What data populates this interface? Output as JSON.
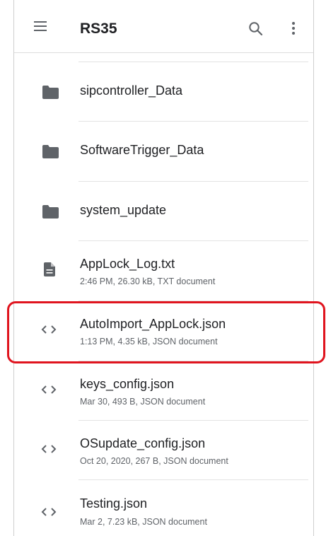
{
  "appbar": {
    "title": "RS35",
    "menu_icon": "menu-icon",
    "search_icon": "search-icon",
    "more_icon": "more-vert-icon"
  },
  "files": [
    {
      "name": "sipcontroller_Data",
      "meta": "",
      "kind": "folder",
      "icon": "folder-icon"
    },
    {
      "name": "SoftwareTrigger_Data",
      "meta": "",
      "kind": "folder",
      "icon": "folder-icon"
    },
    {
      "name": "system_update",
      "meta": "",
      "kind": "folder",
      "icon": "folder-icon"
    },
    {
      "name": "AppLock_Log.txt",
      "meta": "2:46 PM, 26.30 kB, TXT document",
      "kind": "text",
      "icon": "text-file-icon"
    },
    {
      "name": "AutoImport_AppLock.json",
      "meta": "1:13 PM, 4.35 kB, JSON document",
      "kind": "json",
      "icon": "code-file-icon",
      "highlighted": true
    },
    {
      "name": "keys_config.json",
      "meta": "Mar 30, 493 B, JSON document",
      "kind": "json",
      "icon": "code-file-icon"
    },
    {
      "name": "OSupdate_config.json",
      "meta": "Oct 20, 2020, 267 B, JSON document",
      "kind": "json",
      "icon": "code-file-icon"
    },
    {
      "name": "Testing.json",
      "meta": "Mar 2, 7.23 kB, JSON document",
      "kind": "json",
      "icon": "code-file-icon"
    }
  ],
  "colors": {
    "highlight": "#e0141e",
    "icon": "#5f6368",
    "text_primary": "#202124",
    "text_secondary": "#5f6368"
  }
}
